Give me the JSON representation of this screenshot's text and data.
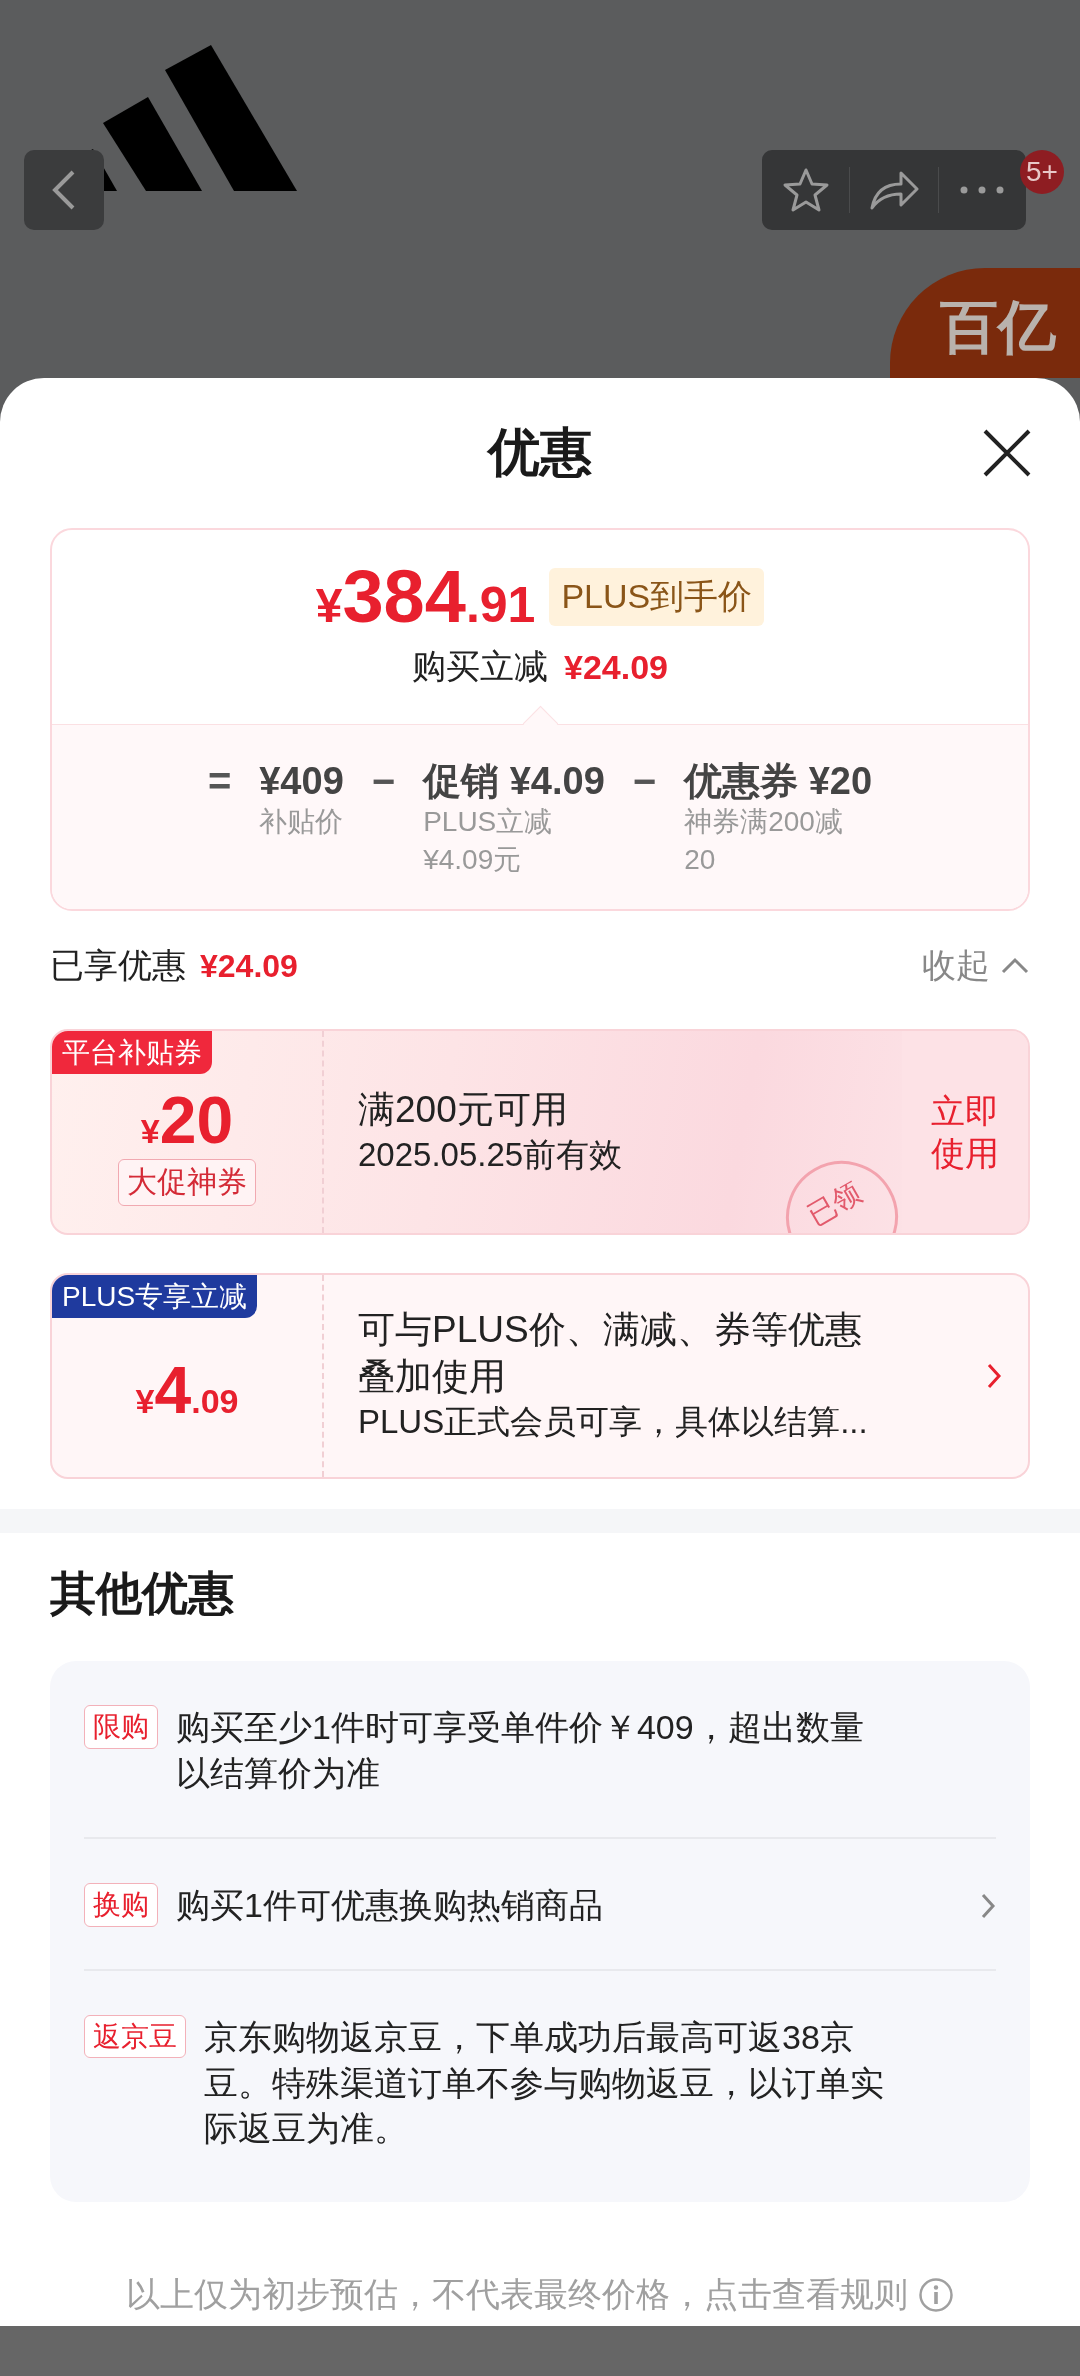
{
  "top_bar": {
    "badge": "5+",
    "promo_badge": "百亿"
  },
  "sheet": {
    "title": "优惠"
  },
  "price_summary": {
    "currency": "¥",
    "price_int": "384",
    "price_dec": ".91",
    "price_label": "PLUS到手价",
    "saving_label": "购买立减",
    "saving": "¥24.09",
    "breakdown": [
      {
        "operator": "=",
        "title": "¥409",
        "notes": [
          "补贴价"
        ]
      },
      {
        "operator": "−",
        "title": "促销 ¥4.09",
        "notes": [
          "PLUS立减",
          "¥4.09元"
        ]
      },
      {
        "operator": "−",
        "title": "优惠券 ¥20",
        "notes": [
          "神券满200减",
          "20"
        ]
      }
    ]
  },
  "applied": {
    "label": "已享优惠",
    "amount": "¥24.09",
    "toggle": "收起",
    "expanded": true
  },
  "coupons": [
    {
      "kind": "coupon",
      "tag": "平台补贴券",
      "color": "#f0283c",
      "currency": "¥",
      "amount_int": "20",
      "badge": "大促神券",
      "title": "满200元可用",
      "subtitle": "2025.05.25前有效",
      "action": "立即使用",
      "stamp": "已领"
    },
    {
      "kind": "discount",
      "tag": "PLUS专享立减",
      "color": "#1f3a9e",
      "currency": "¥",
      "amount_int": "4",
      "amount_dec": ".09",
      "title": "可与PLUS价、满减、券等优惠叠加使用",
      "subtitle": "PLUS正式会员可享，具体以结算..."
    }
  ],
  "other_offers": {
    "title": "其他优惠",
    "items": [
      {
        "tag": "限购",
        "text": "购买至少1件时可享受单件价￥409，超出数量以结算价为准",
        "arrow": false
      },
      {
        "tag": "换购",
        "text": "购买1件可优惠换购热销商品",
        "arrow": true
      },
      {
        "tag": "返京豆",
        "text": "京东购物返京豆，下单成功后最高可返38京豆。特殊渠道订单不参与购物返豆，以订单实际返豆为准。",
        "arrow": false
      }
    ]
  },
  "footer": {
    "text": "以上仅为初步预估，不代表最终价格，点击查看规则"
  }
}
